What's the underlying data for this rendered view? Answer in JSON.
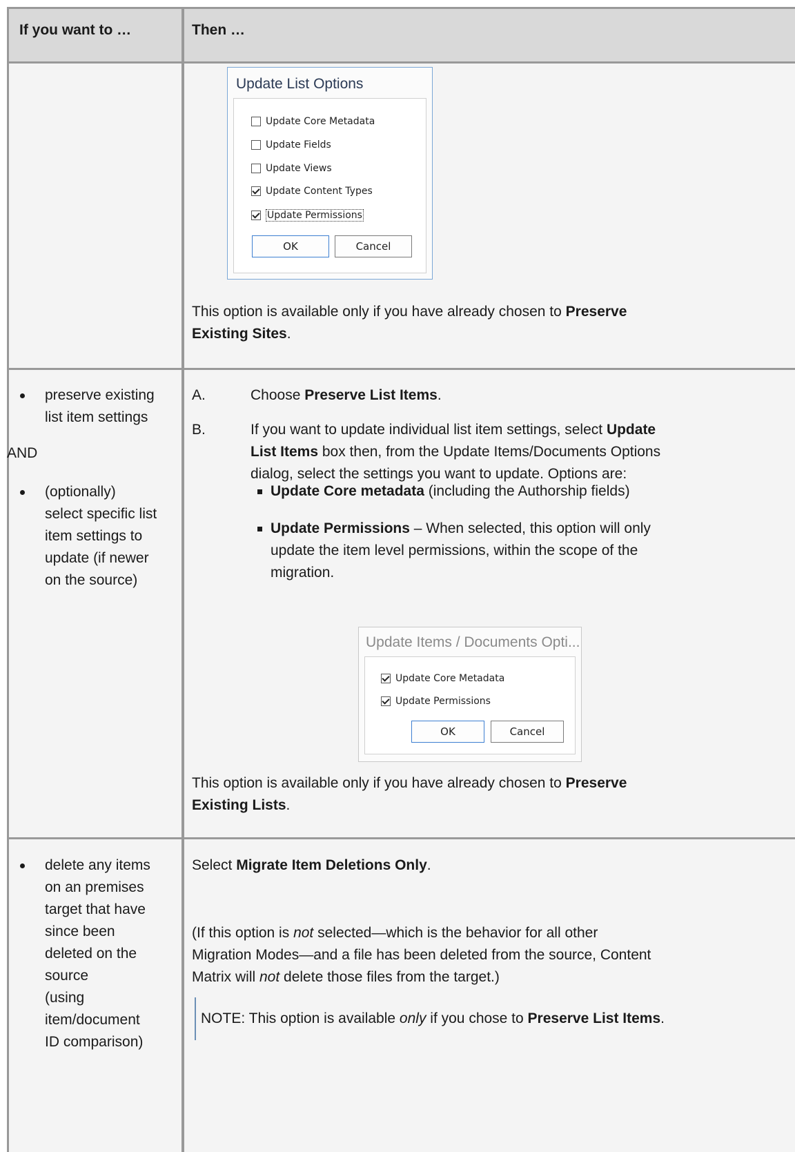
{
  "header": {
    "col1": "If you want to …",
    "col2": "Then …"
  },
  "row1": {
    "dialog": {
      "title": "Update List Options",
      "options": [
        {
          "label": "Update Core Metadata",
          "checked": false
        },
        {
          "label": "Update Fields",
          "checked": false
        },
        {
          "label": "Update Views",
          "checked": false
        },
        {
          "label": "Update Content Types",
          "checked": true
        },
        {
          "label": "Update Permissions",
          "checked": true
        }
      ],
      "ok": "OK",
      "cancel": "Cancel"
    },
    "note_pre": "This option is available only if you have  already chosen to ",
    "note_bold_1": "Preserve",
    "note_bold_2": "Existing Sites",
    "note_post": "."
  },
  "row2": {
    "left": {
      "bullet1": [
        "preserve existing",
        "list item settings"
      ],
      "and": "AND",
      "bullet2": [
        "(optionally)",
        "select specific list",
        "item settings to",
        "update (if newer",
        "on the source)"
      ]
    },
    "stepA_marker": "A.",
    "stepA_pre": "Choose ",
    "stepA_bold": "Preserve List Items",
    "stepA_post": ".",
    "stepB_marker": "B.",
    "stepB_l1_pre": "If you want to update individual list item settings, select ",
    "stepB_l1_bold": "Update",
    "stepB_l2_bold": "List Items",
    "stepB_l2_post": " box then, from the Update Items/Documents Options",
    "stepB_l3": "dialog, select the settings you want to update.  Options are:",
    "opt1_bold": "Update Core metadata",
    "opt1_post": "  (including the Authorship fields)",
    "opt2_bold": "Update Permissions",
    "opt2_post": " – When selected, this  option will only",
    "opt2_l2": "update the item level permissions, within the scope of the",
    "opt2_l3": "migration.",
    "dialog": {
      "title": "Update Items / Documents Opti...",
      "options": [
        {
          "label": "Update Core Metadata",
          "checked": true
        },
        {
          "label": "Update Permissions",
          "checked": true
        }
      ],
      "ok": "OK",
      "cancel": "Cancel"
    },
    "note_pre": "This option is available only if you have  already chosen to ",
    "note_bold_1": "Preserve",
    "note_bold_2": "Existing Lists",
    "note_post": "."
  },
  "row3": {
    "left": [
      "delete any items",
      "on an premises",
      "target that have",
      "since been",
      "deleted on the",
      "source",
      "(using",
      "item/document",
      "ID comparison)"
    ],
    "select_pre": "Select ",
    "select_bold": "Migrate Item Deletions Only",
    "select_post": ".",
    "para_l1_pre": "(If this option is ",
    "para_l1_em": "not",
    "para_l1_post": " selected—which is the behavior for all other",
    "para_l2": "Migration Modes—and a file has been deleted from the source, Content",
    "para_l3_pre": "Matrix will ",
    "para_l3_em": "not",
    "para_l3_post": " delete those files from the target.)",
    "note_pre": "NOTE:  This option is available ",
    "note_em": "only",
    "note_mid": " if you chose to ",
    "note_bold": "Preserve List Items",
    "note_post": "."
  }
}
